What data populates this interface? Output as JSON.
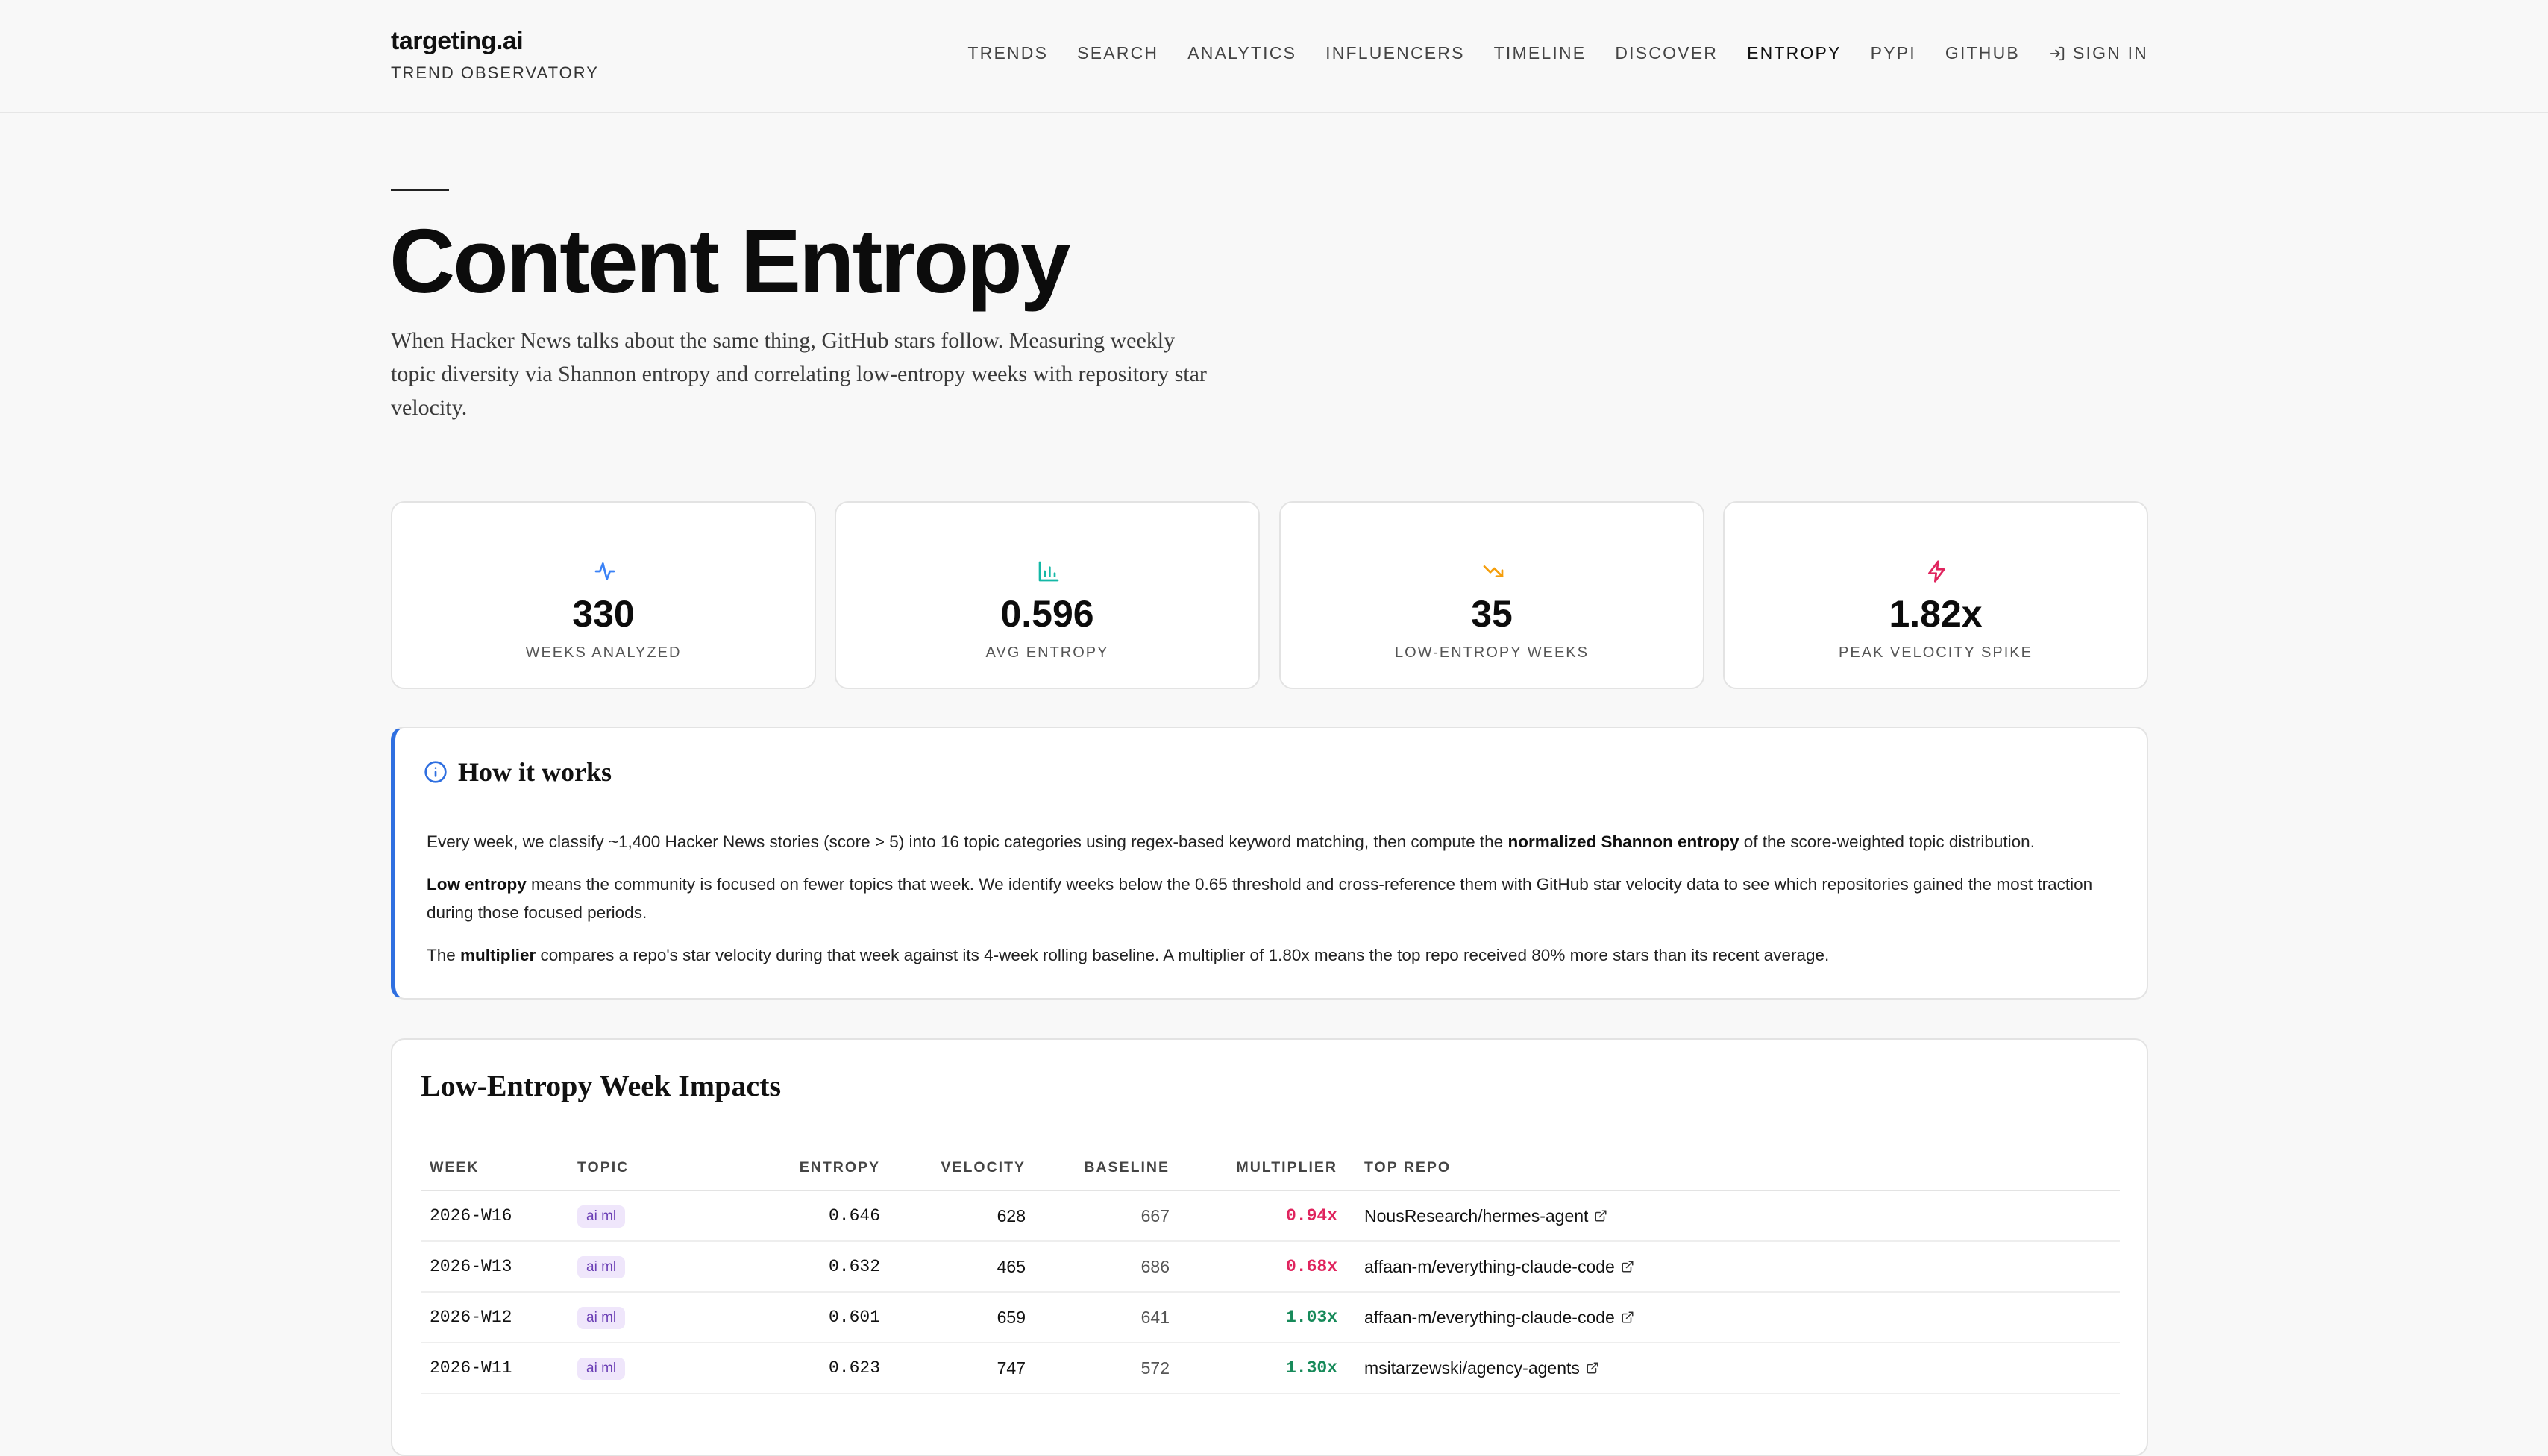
{
  "brand": {
    "name": "targeting.ai",
    "subtitle": "TREND OBSERVATORY"
  },
  "nav": {
    "items": [
      {
        "label": "TRENDS"
      },
      {
        "label": "SEARCH"
      },
      {
        "label": "ANALYTICS"
      },
      {
        "label": "INFLUENCERS"
      },
      {
        "label": "TIMELINE"
      },
      {
        "label": "DISCOVER"
      },
      {
        "label": "ENTROPY",
        "active": true
      },
      {
        "label": "PYPI"
      },
      {
        "label": "GITHUB"
      }
    ],
    "sign_in": {
      "label": "SIGN IN",
      "icon": "sign-in-icon"
    }
  },
  "page": {
    "title": "Content Entropy",
    "lead": "When Hacker News talks about the same thing, GitHub stars follow. Measuring weekly topic diversity via Shannon entropy and correlating low-entropy weeks with repository star velocity."
  },
  "stats": [
    {
      "value": "330",
      "label": "WEEKS ANALYZED",
      "icon": "activity-icon",
      "color": "#3b82f6"
    },
    {
      "value": "0.596",
      "label": "AVG ENTROPY",
      "icon": "bar-chart-icon",
      "color": "#14b8a6"
    },
    {
      "value": "35",
      "label": "LOW-ENTROPY WEEKS",
      "icon": "trending-down-icon",
      "color": "#f59e0b"
    },
    {
      "value": "1.82x",
      "label": "PEAK VELOCITY SPIKE",
      "icon": "zap-icon",
      "color": "#e0245e"
    }
  ],
  "how": {
    "title": "How it works",
    "p1_pre": "Every week, we classify ~1,400 Hacker News stories (score > 5) into 16 topic categories using regex-based keyword matching, then compute the ",
    "p1_bold": "normalized Shannon entropy",
    "p1_post": " of the score-weighted topic distribution.",
    "p2_bold": "Low entropy",
    "p2_post": " means the community is focused on fewer topics that week. We identify weeks below the 0.65 threshold and cross-reference them with GitHub star velocity data to see which repositories gained the most traction during those focused periods.",
    "p3_pre": "The ",
    "p3_bold": "multiplier",
    "p3_post": " compares a repo's star velocity during that week against its 4-week rolling baseline. A multiplier of 1.80x means the top repo received 80% more stars than its recent average."
  },
  "impacts": {
    "title": "Low-Entropy Week Impacts",
    "columns": {
      "week": "WEEK",
      "topic": "TOPIC",
      "entropy": "ENTROPY",
      "velocity": "VELOCITY",
      "baseline": "BASELINE",
      "multiplier": "MULTIPLIER",
      "repo": "TOP REPO"
    },
    "rows": [
      {
        "week": "2026-W16",
        "topic": "ai ml",
        "entropy": "0.646",
        "velocity": "628",
        "baseline": "667",
        "multiplier": "0.94x",
        "repo": "NousResearch/hermes-agent"
      },
      {
        "week": "2026-W13",
        "topic": "ai ml",
        "entropy": "0.632",
        "velocity": "465",
        "baseline": "686",
        "multiplier": "0.68x",
        "repo": "affaan-m/everything-claude-code"
      },
      {
        "week": "2026-W12",
        "topic": "ai ml",
        "entropy": "0.601",
        "velocity": "659",
        "baseline": "641",
        "multiplier": "1.03x",
        "repo": "affaan-m/everything-claude-code"
      },
      {
        "week": "2026-W11",
        "topic": "ai ml",
        "entropy": "0.623",
        "velocity": "747",
        "baseline": "572",
        "multiplier": "1.30x",
        "repo": "msitarzewski/agency-agents"
      }
    ]
  }
}
